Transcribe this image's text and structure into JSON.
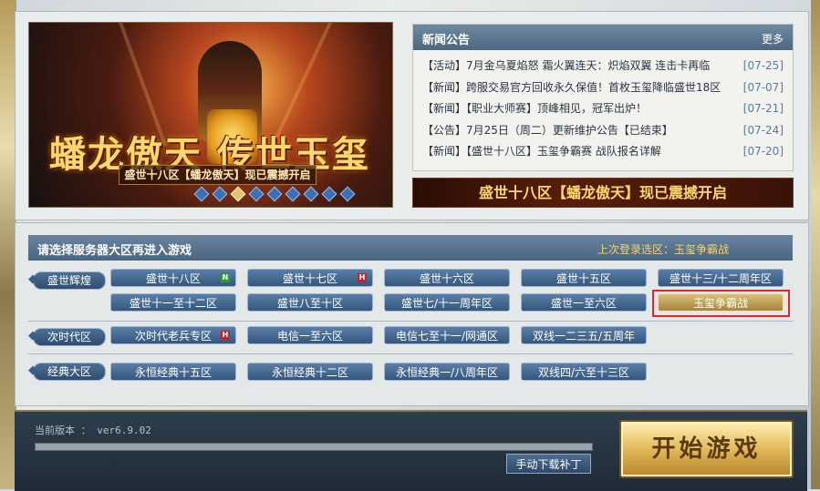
{
  "banner": {
    "title_art": "蟠龙傲天 传世玉玺",
    "subtitle": "盛世十八区【蟠龙傲天】现已震撼开启",
    "slide_count": 9,
    "active_slide": 3
  },
  "news": {
    "title": "新闻公告",
    "more": "更多",
    "items": [
      {
        "text": "【活动】7月金乌夏焰怒 霜火翼连天：炽焰双翼 连击卡再临",
        "date": "[07-25]"
      },
      {
        "text": "【新闻】跨服交易官方回收永久保值！首枚玉玺降临盛世18区",
        "date": "[07-07]"
      },
      {
        "text": "【新闻】【职业大师赛】顶峰相见，冠军出炉！",
        "date": "[07-21]"
      },
      {
        "text": "【公告】7月25日（周二）更新维护公告【已结束】",
        "date": "[07-24]"
      },
      {
        "text": "【新闻】【盛世十八区】玉玺争霸赛 战队报名详解",
        "date": "[07-20]"
      }
    ]
  },
  "slogan": "盛世十八区【蟠龙傲天】现已震撼开启",
  "server_select": {
    "title": "请选择服务器大区再进入游戏",
    "last_login": "上次登录选区：玉玺争霸战"
  },
  "categories": {
    "shengshi": "盛世辉煌",
    "cishidai": "次时代区",
    "jingdian": "经典大区"
  },
  "servers": {
    "s18": {
      "label": "盛世十八区",
      "badge": "N"
    },
    "s17": {
      "label": "盛世十七区",
      "badge": "H"
    },
    "s16": {
      "label": "盛世十六区"
    },
    "s15": {
      "label": "盛世十五区"
    },
    "s13": {
      "label": "盛世十三/十二周年区"
    },
    "s11": {
      "label": "盛世十一至十二区"
    },
    "s8": {
      "label": "盛世八至十区"
    },
    "s7": {
      "label": "盛世七/十一周年区"
    },
    "s1": {
      "label": "盛世一至六区"
    },
    "yuxi": {
      "label": "玉玺争霸战"
    },
    "veteran": {
      "label": "次时代老兵专区",
      "badge": "H"
    },
    "dx1": {
      "label": "电信一至六区"
    },
    "dx7": {
      "label": "电信七至十一/网通区"
    },
    "sx": {
      "label": "双线一二三五/五周年"
    },
    "jd15": {
      "label": "永恒经典十五区"
    },
    "jd12": {
      "label": "永恒经典十二区"
    },
    "jd1": {
      "label": "永恒经典一/八周年区"
    },
    "sx4": {
      "label": "双线四/六至十三区"
    }
  },
  "footer": {
    "version": "当前版本 ： ver6.9.02",
    "progress": 1.0,
    "patch_button": "手动下载补丁",
    "start_button": "开始游戏"
  },
  "colors": {
    "accent_gold": "#e3c36b",
    "highlight_red": "#e0262b",
    "nav_blue": "#4a6580"
  }
}
